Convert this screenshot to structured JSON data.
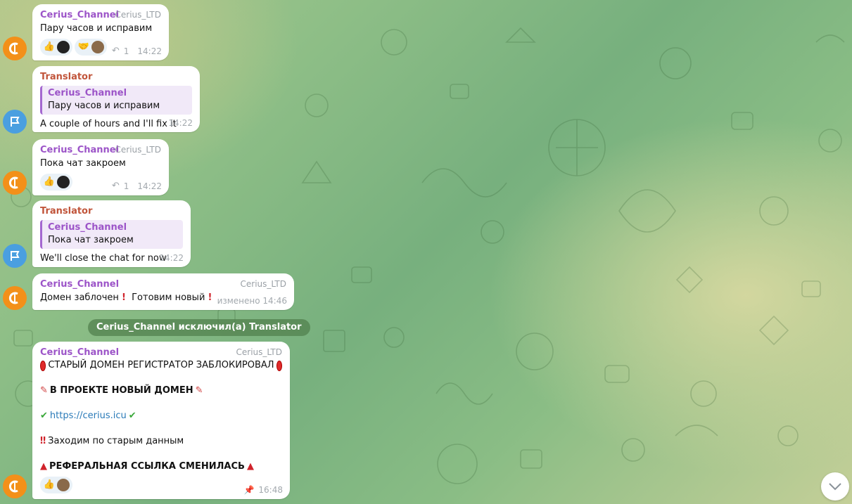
{
  "messages": [
    {
      "sender": "Cerius_Channel",
      "signature": "Cerius_LTD",
      "text": "Пару часов и исправим",
      "replies": "1",
      "time": "14:22"
    },
    {
      "sender": "Translator",
      "quote_sender": "Cerius_Channel",
      "quote_text": "Пару часов и исправим",
      "text": "A couple of hours and I'll fix it",
      "time": "14:22"
    },
    {
      "sender": "Cerius_Channel",
      "signature": "Cerius_LTD",
      "text": "Пока чат закроем",
      "replies": "1",
      "time": "14:22"
    },
    {
      "sender": "Translator",
      "quote_sender": "Cerius_Channel",
      "quote_text": "Пока чат закроем",
      "text": "We'll close the chat for now",
      "time": "14:22"
    },
    {
      "sender": "Cerius_Channel",
      "signature": "Cerius_LTD",
      "text": "Домен заблочен",
      "text2": "Готовим новый",
      "time": "изменено 14:46"
    }
  ],
  "service_message": "Cerius_Channel исключил(а) Translator",
  "post": {
    "sender": "Cerius_Channel",
    "signature": "Cerius_LTD",
    "line1": "СТАРЫЙ ДОМЕН РЕГИСТРАТОР ЗАБЛОКИРОВАЛ",
    "line2": "В ПРОЕКТЕ НОВЫЙ ДОМЕН",
    "link": "https://cerius.icu",
    "line4": "Заходим по старым данным",
    "line5": "РЕФЕРАЛЬНАЯ ССЫЛКА СМЕНИЛАСЬ",
    "time": "16:48"
  },
  "colors": {
    "sender": "#9c54c8",
    "translator": "#c1553b",
    "channel_avatar": "#f39019",
    "translator_avatar": "#4a9fe0",
    "link": "#2a7ab8"
  },
  "icons": {
    "reply": "reply-arrow-icon",
    "pin": "pin-icon",
    "scroll": "chevron-down-icon"
  }
}
